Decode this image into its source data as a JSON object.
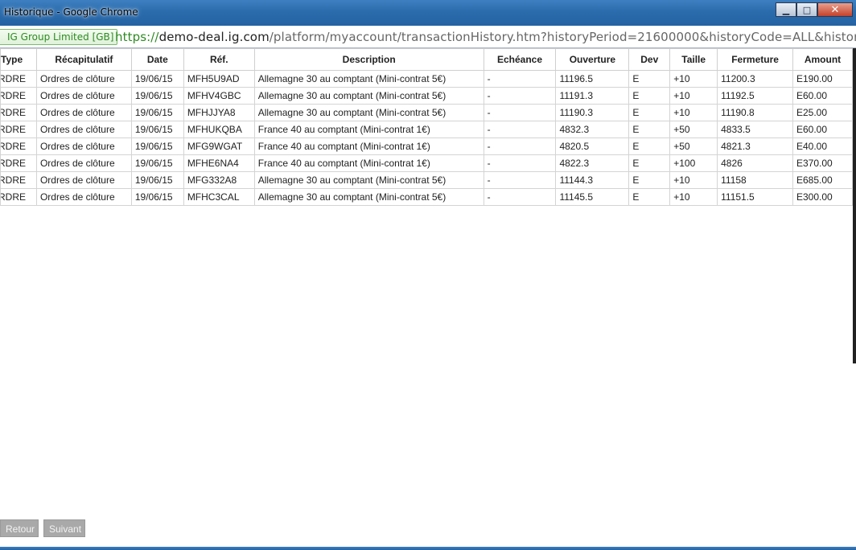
{
  "window": {
    "title": "Historique - Google Chrome",
    "minimize_glyph": "▁",
    "maximize_glyph": "□",
    "close_glyph": "✕"
  },
  "address": {
    "ev_label": "IG Group Limited [GB]",
    "scheme": "https://",
    "host": "demo-deal.ig.com",
    "path": "/platform/myaccount/transactionHistory.htm?historyPeriod=21600000&historyCode=ALL&historyDateFr"
  },
  "table": {
    "headers": [
      "Type",
      "Récapitulatif",
      "Date",
      "Réf.",
      "Description",
      "Echéance",
      "Ouverture",
      "Dev",
      "Taille",
      "Fermeture",
      "Amount"
    ],
    "rows": [
      [
        "RDRE",
        "Ordres de clôture",
        "19/06/15",
        "MFH5U9AD",
        "Allemagne 30 au comptant (Mini-contrat 5€)",
        "-",
        "11196.5",
        "E",
        "+10",
        "11200.3",
        "E190.00"
      ],
      [
        "RDRE",
        "Ordres de clôture",
        "19/06/15",
        "MFHV4GBC",
        "Allemagne 30 au comptant (Mini-contrat 5€)",
        "-",
        "11191.3",
        "E",
        "+10",
        "11192.5",
        "E60.00"
      ],
      [
        "RDRE",
        "Ordres de clôture",
        "19/06/15",
        "MFHJJYA8",
        "Allemagne 30 au comptant (Mini-contrat 5€)",
        "-",
        "11190.3",
        "E",
        "+10",
        "11190.8",
        "E25.00"
      ],
      [
        "RDRE",
        "Ordres de clôture",
        "19/06/15",
        "MFHUKQBA",
        "France 40 au comptant (Mini-contrat 1€)",
        "-",
        "4832.3",
        "E",
        "+50",
        "4833.5",
        "E60.00"
      ],
      [
        "RDRE",
        "Ordres de clôture",
        "19/06/15",
        "MFG9WGAT",
        "France 40 au comptant (Mini-contrat 1€)",
        "-",
        "4820.5",
        "E",
        "+50",
        "4821.3",
        "E40.00"
      ],
      [
        "RDRE",
        "Ordres de clôture",
        "19/06/15",
        "MFHE6NA4",
        "France 40 au comptant (Mini-contrat 1€)",
        "-",
        "4822.3",
        "E",
        "+100",
        "4826",
        "E370.00"
      ],
      [
        "RDRE",
        "Ordres de clôture",
        "19/06/15",
        "MFG332A8",
        "Allemagne 30 au comptant (Mini-contrat 5€)",
        "-",
        "11144.3",
        "E",
        "+10",
        "11158",
        "E685.00"
      ],
      [
        "RDRE",
        "Ordres de clôture",
        "19/06/15",
        "MFHC3CAL",
        "Allemagne 30 au comptant (Mini-contrat 5€)",
        "-",
        "11145.5",
        "E",
        "+10",
        "11151.5",
        "E300.00"
      ]
    ]
  },
  "buttons": {
    "retour": "Retour",
    "suivant": "Suivant"
  },
  "colors": {
    "titlebar": "#2b6cad",
    "ev_green": "#2e8b22",
    "button_gray": "#a9a9a9"
  }
}
